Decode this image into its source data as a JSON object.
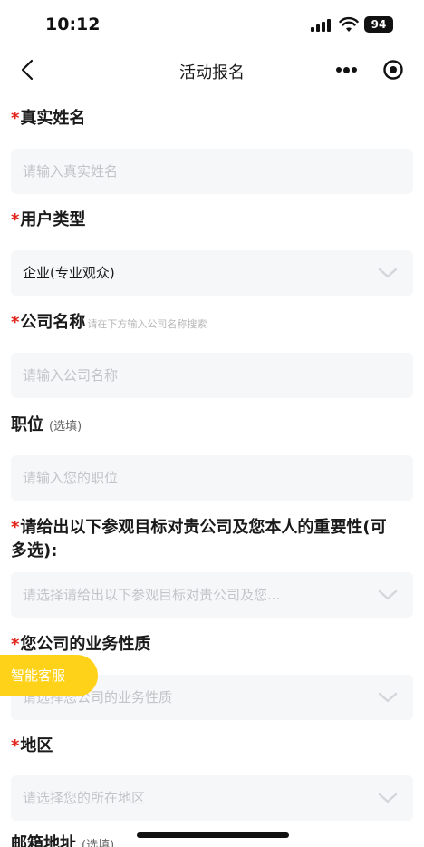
{
  "status_bar": {
    "time": "10:12",
    "battery": "94"
  },
  "nav": {
    "title": "活动报名"
  },
  "form": {
    "name": {
      "label": "真实姓名",
      "placeholder": "请输入真实姓名"
    },
    "user_type": {
      "label": "用户类型",
      "value": "企业(专业观众)"
    },
    "company": {
      "label": "公司名称",
      "hint": "请在下方输入公司名称搜索",
      "placeholder": "请输入公司名称"
    },
    "position": {
      "label": "职位",
      "optional": "(选填)",
      "placeholder": "请输入您的职位"
    },
    "importance": {
      "label_line1": "请给出以下参观目标对贵公司及您本人的重要性(可",
      "label_line2": "多选):",
      "placeholder": "请选择请给出以下参观目标对贵公司及您..."
    },
    "business": {
      "label": "您公司的业务性质",
      "placeholder": "请选择您公司的业务性质"
    },
    "region": {
      "label": "地区",
      "placeholder": "请选择您的所在地区"
    },
    "email": {
      "label": "邮箱地址",
      "optional": "(选填)"
    }
  },
  "required_mark": "*",
  "service_button": {
    "label": "智能客服"
  }
}
